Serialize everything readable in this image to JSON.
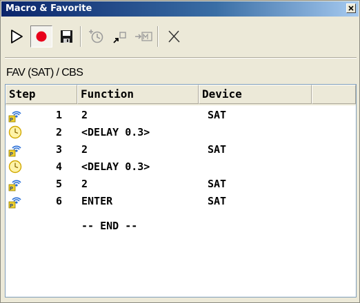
{
  "window": {
    "title": "Macro & Favorite"
  },
  "toolbar": {
    "buttons": [
      {
        "name": "play",
        "icon": "play-icon"
      },
      {
        "name": "record",
        "icon": "record-icon"
      },
      {
        "name": "save",
        "icon": "floppy-disk-icon"
      },
      {
        "name": "add-delay",
        "icon": "add-delay-icon"
      },
      {
        "name": "insert-step",
        "icon": "insert-step-icon"
      },
      {
        "name": "insert-macro",
        "icon": "insert-macro-icon"
      },
      {
        "name": "delete",
        "icon": "delete-x-icon"
      }
    ]
  },
  "macro": {
    "name": "FAV (SAT) / CBS"
  },
  "table": {
    "columns": [
      "Step",
      "Function",
      "Device",
      ""
    ],
    "rows": [
      {
        "type": "ir-command",
        "icon": "remote-signal-icon",
        "step": "1",
        "function": "2",
        "device": "SAT"
      },
      {
        "type": "delay",
        "icon": "clock-icon",
        "step": "2",
        "function": "<DELAY 0.3>",
        "device": ""
      },
      {
        "type": "ir-command",
        "icon": "remote-signal-icon",
        "step": "3",
        "function": "2",
        "device": "SAT"
      },
      {
        "type": "delay",
        "icon": "clock-icon",
        "step": "4",
        "function": "<DELAY 0.3>",
        "device": ""
      },
      {
        "type": "ir-command",
        "icon": "remote-signal-icon",
        "step": "5",
        "function": "2",
        "device": "SAT"
      },
      {
        "type": "ir-command",
        "icon": "remote-signal-icon",
        "step": "6",
        "function": "ENTER",
        "device": "SAT"
      }
    ],
    "end_marker": "-- END --"
  },
  "colors": {
    "title_gradient_start": "#0a246a",
    "title_gradient_end": "#a6caf0",
    "record_red": "#e8001c",
    "panel_background": "#ece9d8"
  }
}
